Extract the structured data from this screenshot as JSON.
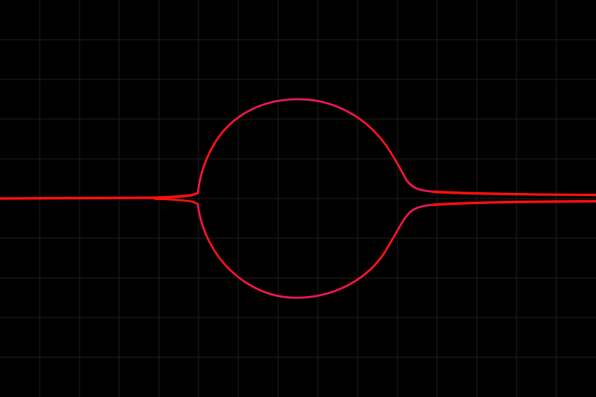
{
  "canvas": {
    "background_color": "#000000",
    "grid": {
      "visible": true,
      "color": "#1e1e1e",
      "columns": 15,
      "rows": 10
    }
  },
  "diagram": {
    "description_free": true,
    "colors": {
      "outer_tails": "#ff1010",
      "circle_top": "#e8186a",
      "circle_bottom": "#f01660",
      "circle_sides": "#ff1414"
    },
    "shape": {
      "kind": "circle-with-tails",
      "tail_left_count": 1,
      "tail_right_count": 2
    }
  }
}
